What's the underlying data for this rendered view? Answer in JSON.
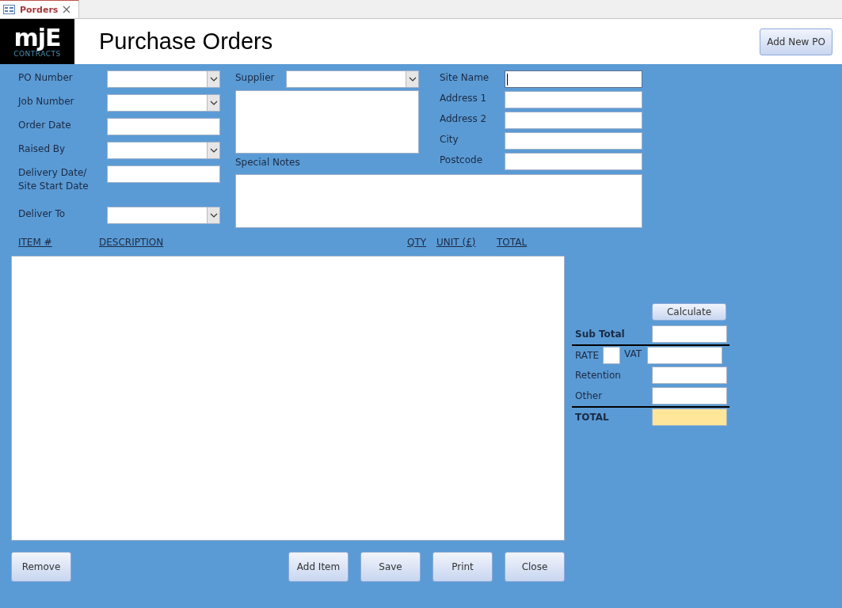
{
  "tab": {
    "label": "Porders",
    "selected": true
  },
  "header": {
    "logo": {
      "mark": "mjE",
      "subtitle": "CONTRACTS"
    },
    "title": "Purchase Orders",
    "button": "Add New PO"
  },
  "order_fields": [
    {
      "label": "PO Number",
      "kind": "combo"
    },
    {
      "label": "Job Number",
      "kind": "combo"
    },
    {
      "label": "Order Date",
      "kind": "text"
    },
    {
      "label": "Raised By",
      "kind": "combo"
    },
    {
      "label": "Delivery Date/ Site Start Date",
      "kind": "text"
    },
    {
      "label": "Deliver To",
      "kind": "combo"
    }
  ],
  "supplier": {
    "label": "Supplier",
    "kind": "combo"
  },
  "special_notes": {
    "label": "Special Notes"
  },
  "site_fields": [
    {
      "label": "Site Name",
      "focused": true
    },
    {
      "label": "Address 1",
      "focused": false
    },
    {
      "label": "Address 2",
      "focused": false
    },
    {
      "label": "City",
      "focused": false
    },
    {
      "label": "Postcode",
      "focused": false
    }
  ],
  "items": {
    "columns": [
      "ITEM #",
      "DESCRIPTION",
      "QTY",
      "UNIT (£)",
      "TOTAL"
    ]
  },
  "totals": {
    "button": "Calculate",
    "rows": [
      {
        "kind": "plain",
        "label": "Sub Total",
        "bold": true,
        "highlight": false,
        "divider_before": false
      },
      {
        "kind": "rate",
        "rate_label": "RATE",
        "label": "VAT",
        "bold": false,
        "highlight": false,
        "divider_before": true
      },
      {
        "kind": "plain",
        "label": "Retention",
        "bold": false,
        "highlight": false,
        "divider_before": false
      },
      {
        "kind": "plain",
        "label": "Other",
        "bold": false,
        "highlight": false,
        "divider_before": false
      },
      {
        "kind": "plain",
        "label": "TOTAL",
        "bold": true,
        "highlight": true,
        "divider_before": true
      }
    ]
  },
  "buttons_left": [
    "Remove"
  ],
  "buttons_right": [
    "Add Item",
    "Save",
    "Print",
    "Close"
  ]
}
